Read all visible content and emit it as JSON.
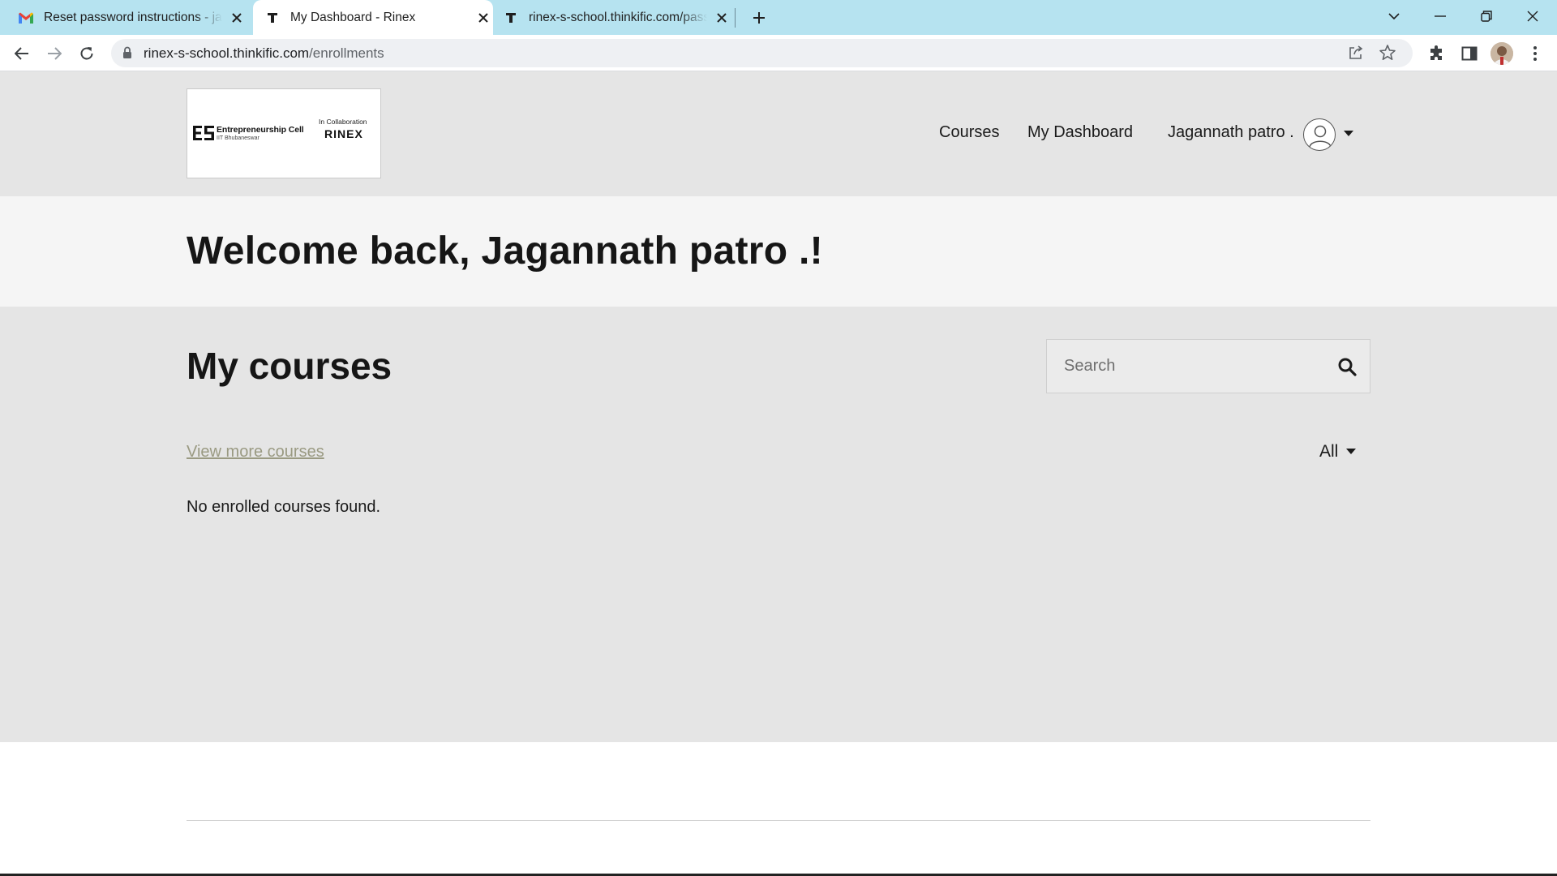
{
  "browser": {
    "tabs": [
      {
        "title": "Reset password instructions - jagannath",
        "favicon": "gmail-icon"
      },
      {
        "title": "My Dashboard - Rinex",
        "favicon": "thinkific-icon"
      },
      {
        "title": "rinex-s-school.thinkific.com/password",
        "favicon": "thinkific-icon"
      }
    ],
    "address": {
      "host": "rinex-s-school.thinkific.com",
      "path": "/enrollments"
    }
  },
  "header": {
    "logo": {
      "ecell_name": "Entrepreneurship Cell",
      "ecell_sub": "IIT Bhubaneswar",
      "collab": "In Collaboration",
      "partner": "RINEX"
    },
    "nav": {
      "courses": "Courses",
      "dashboard": "My Dashboard",
      "user": "Jagannath patro ."
    }
  },
  "welcome": {
    "title": "Welcome back, Jagannath patro .!"
  },
  "courses": {
    "title": "My courses",
    "search_placeholder": "Search",
    "view_more": "View more courses",
    "filter": "All",
    "empty": "No enrolled courses found."
  },
  "colors": {
    "tabstrip": "#b6e3f0",
    "header_bg": "#e5e5e5",
    "welcome_bg": "#f5f5f5",
    "link_muted": "#9a9a82"
  }
}
